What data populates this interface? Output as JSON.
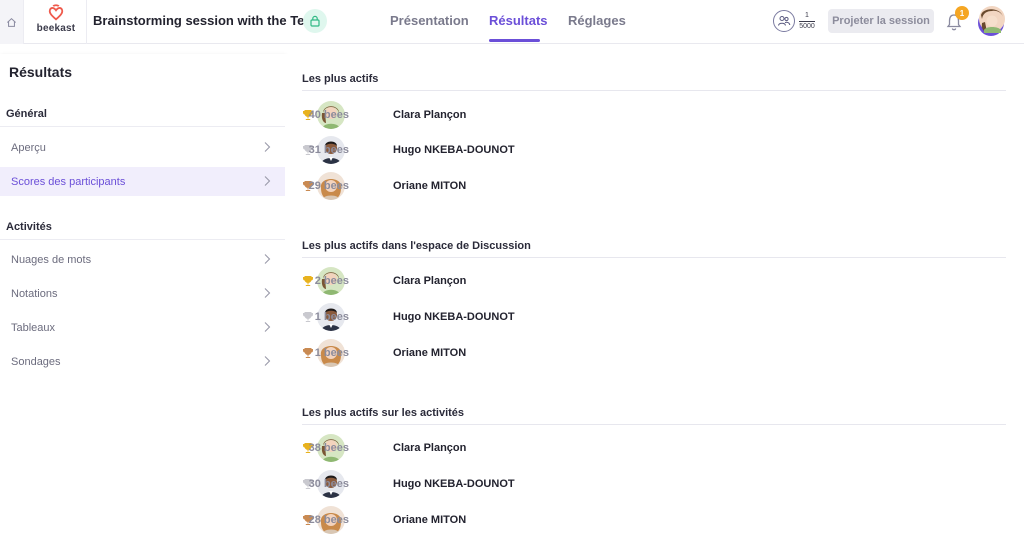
{
  "app": {
    "logo_text": "beekast",
    "session_title": "Brainstorming session with the Team",
    "brand_color": "#6b4fd8"
  },
  "tabs": [
    {
      "label": "Présentation"
    },
    {
      "label": "Résultats",
      "active": true
    },
    {
      "label": "Réglages"
    }
  ],
  "header": {
    "participants_current": "1",
    "participants_max": "5000",
    "project_button": "Projeter la session",
    "notification_count": "1"
  },
  "sidebar": {
    "title": "Résultats",
    "sections": [
      {
        "label": "Général",
        "items": [
          {
            "label": "Aperçu"
          },
          {
            "label": "Scores des participants",
            "active": true
          }
        ]
      },
      {
        "label": "Activités",
        "items": [
          {
            "label": "Nuages de mots"
          },
          {
            "label": "Notations"
          },
          {
            "label": "Tableaux"
          },
          {
            "label": "Sondages"
          }
        ]
      }
    ]
  },
  "leaderboards": [
    {
      "title": "Les plus actifs",
      "rows": [
        {
          "bees": "40 bees",
          "name": "Clara Plançon",
          "trophy": "gold"
        },
        {
          "bees": "31 bees",
          "name": "Hugo NKEBA-DOUNOT",
          "trophy": "silver"
        },
        {
          "bees": "29 bees",
          "name": "Oriane MITON",
          "trophy": "bronze"
        }
      ]
    },
    {
      "title": "Les plus actifs dans l'espace de Discussion",
      "rows": [
        {
          "bees": "2 bees",
          "name": "Clara Plançon",
          "trophy": "gold"
        },
        {
          "bees": "1 bees",
          "name": "Hugo NKEBA-DOUNOT",
          "trophy": "silver"
        },
        {
          "bees": "1 bees",
          "name": "Oriane MITON",
          "trophy": "bronze"
        }
      ]
    },
    {
      "title": "Les plus actifs sur les activités",
      "rows": [
        {
          "bees": "38 bees",
          "name": "Clara Plançon",
          "trophy": "gold"
        },
        {
          "bees": "30 bees",
          "name": "Hugo NKEBA-DOUNOT",
          "trophy": "silver"
        },
        {
          "bees": "28 bees",
          "name": "Oriane MITON",
          "trophy": "bronze"
        }
      ]
    }
  ],
  "trophy_colors": {
    "gold": "#e8b21e",
    "silver": "#c9c9cf",
    "bronze": "#c98a52"
  }
}
